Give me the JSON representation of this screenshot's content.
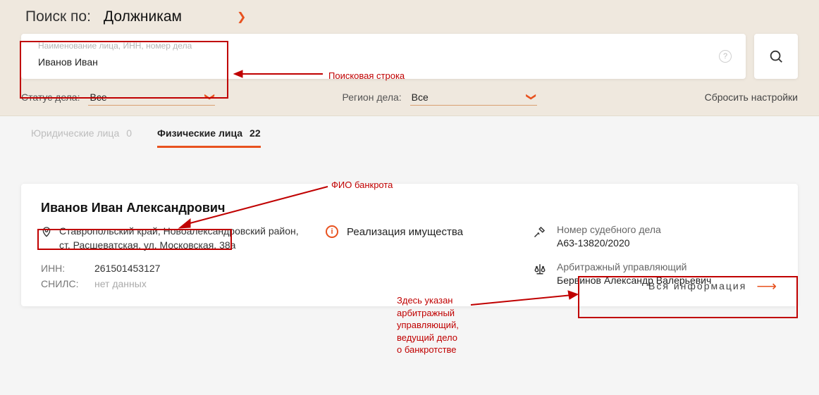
{
  "searchBy": {
    "label": "Поиск по:",
    "category": "Должникам"
  },
  "searchInput": {
    "placeholder": "Наименование лица, ИНН, номер дела",
    "value": "Иванов Иван"
  },
  "help": "?",
  "filters": {
    "status": {
      "label": "Статус дела:",
      "value": "Все"
    },
    "region": {
      "label": "Регион дела:",
      "value": "Все"
    },
    "reset": "Сбросить настройки"
  },
  "tabs": {
    "legal": {
      "label": "Юридические лица",
      "count": "0"
    },
    "individual": {
      "label": "Физические лица",
      "count": "22"
    }
  },
  "card": {
    "name": "Иванов Иван Александрович",
    "address": "Ставропольский край, Новоалександровский район, ст. Расшеватская, ул. Московская, 38а",
    "inn_label": "ИНН:",
    "inn": "261501453127",
    "snils_label": "СНИЛС:",
    "snils": "нет данных",
    "status": "Реализация имущества",
    "caseNumberLabel": "Номер судебного дела",
    "caseNumber": "А63-13820/2020",
    "managerLabel": "Арбитражный управляющий",
    "managerName": "Бервинов Александр Валерьевич",
    "moreLink": "Вся информация"
  },
  "annotations": {
    "a1": "Поисковая строка",
    "a2": "ФИО банкрота",
    "a3": "Здесь указан\nарбитражный\nуправляющий,\nведущий дело\nо банкротстве"
  }
}
